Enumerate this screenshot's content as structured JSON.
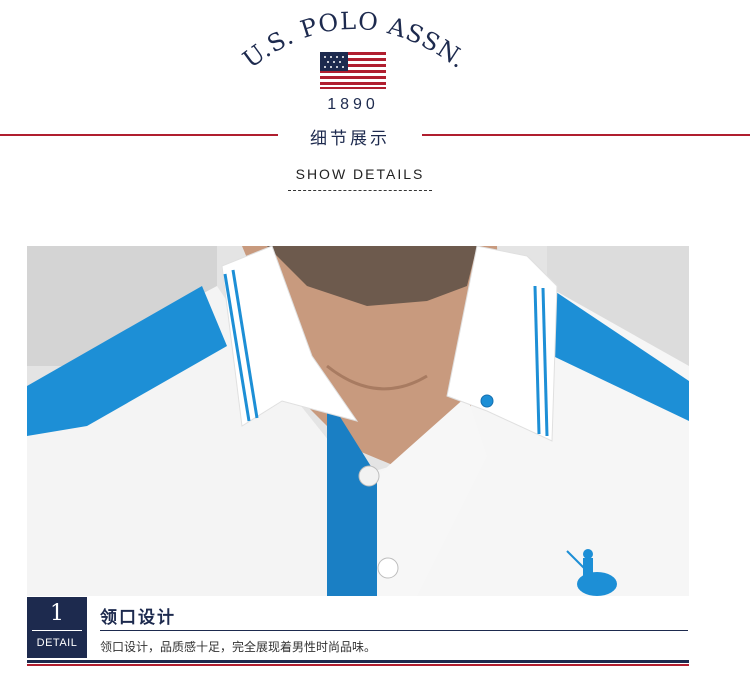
{
  "brand": {
    "name": "U.S. POLO ASSN.",
    "year": "1890"
  },
  "header": {
    "title_cn": "细节展示",
    "title_en": "SHOW DETAILS"
  },
  "detail": {
    "number": "1",
    "label": "DETAIL",
    "title": "领口设计",
    "description": "领口设计，品质感十足，完全展现着男性时尚品味。"
  },
  "colors": {
    "navy": "#1d2a4e",
    "red": "#b01e2f",
    "shirt_blue": "#1d8fd6"
  }
}
